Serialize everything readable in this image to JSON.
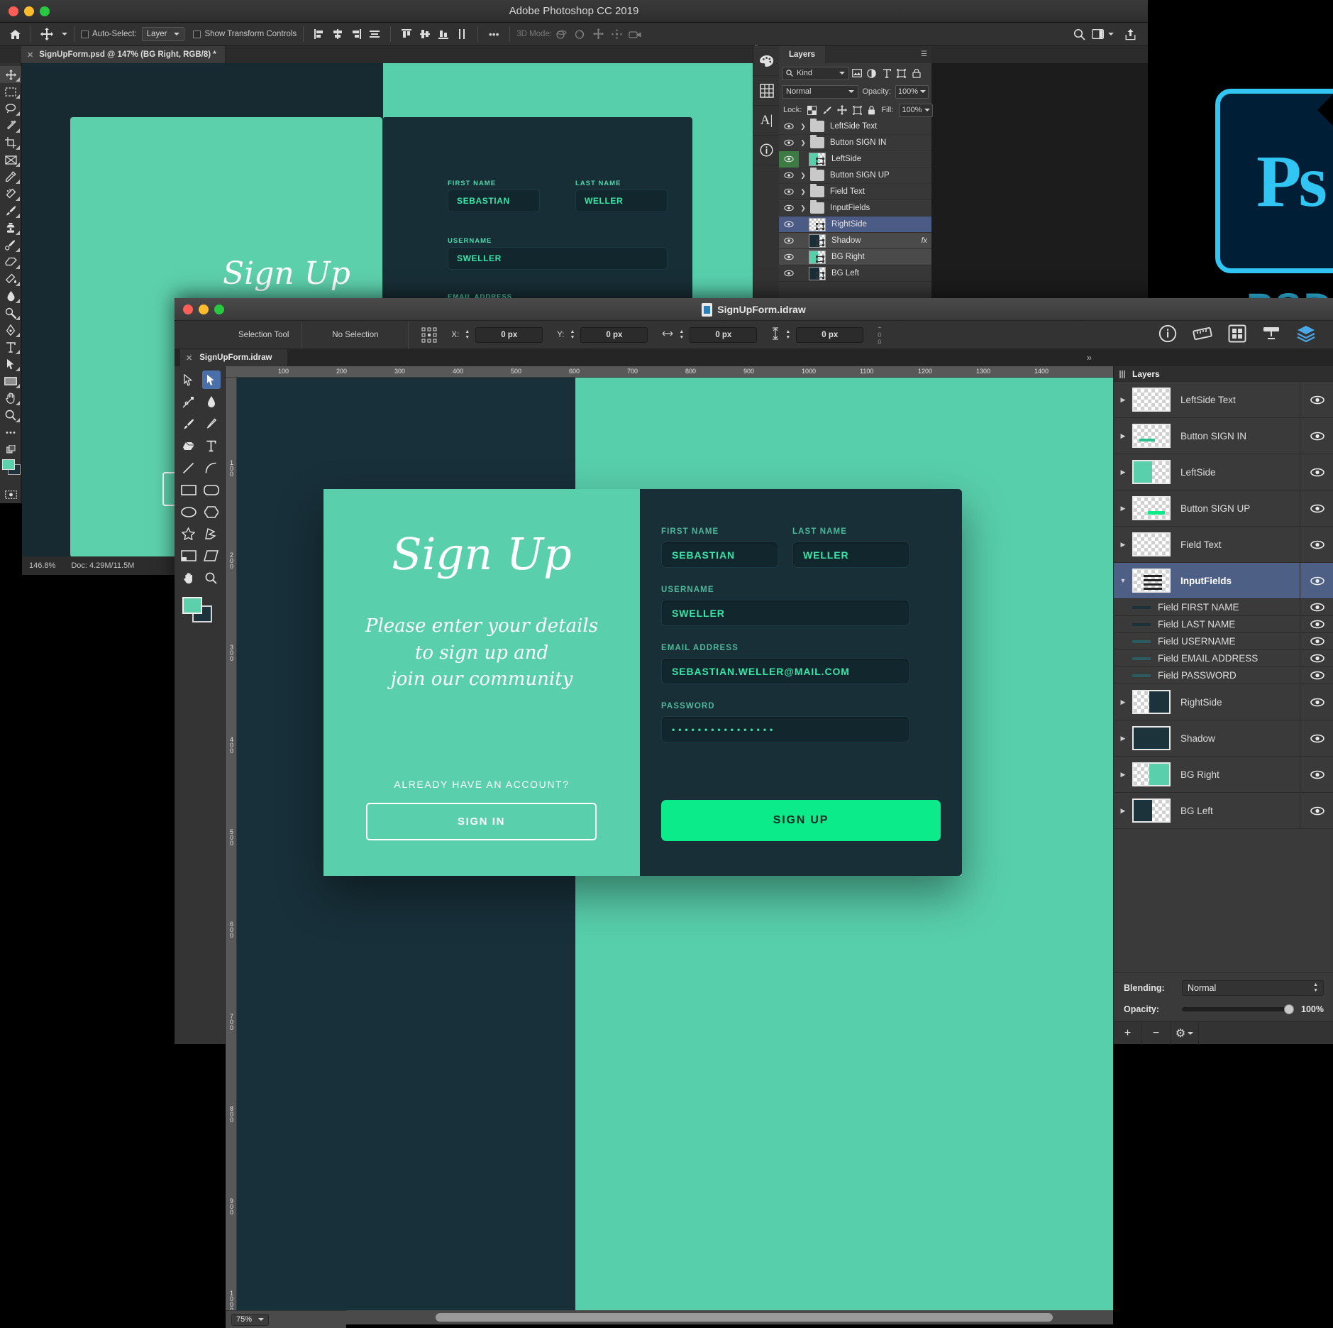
{
  "photoshop": {
    "window_title": "Adobe Photoshop CC 2019",
    "options_bar": {
      "auto_select_label": "Auto-Select:",
      "auto_select_value": "Layer",
      "show_transform_label": "Show Transform Controls",
      "more_label": "•••",
      "mode_3d_label": "3D Mode:"
    },
    "document_tab": "SignUpForm.psd @ 147% (BG Right, RGB/8) *",
    "status": {
      "zoom": "146.8%",
      "doc": "Doc: 4.29M/11.5M"
    },
    "layers_panel": {
      "title": "Layers",
      "filter_kind": "Kind",
      "blend_mode": "Normal",
      "opacity_label": "Opacity:",
      "opacity_value": "100%",
      "lock_label": "Lock:",
      "fill_label": "Fill:",
      "fill_value": "100%",
      "layers": [
        {
          "name": "LeftSide Text",
          "type": "group",
          "selected": "none",
          "fx": ""
        },
        {
          "name": "Button SIGN IN",
          "type": "group",
          "selected": "none",
          "fx": ""
        },
        {
          "name": "LeftSide",
          "type": "image-green",
          "selected": "green-eye",
          "fx": ""
        },
        {
          "name": "Button SIGN UP",
          "type": "group",
          "selected": "none",
          "fx": ""
        },
        {
          "name": "Field Text",
          "type": "group",
          "selected": "none",
          "fx": ""
        },
        {
          "name": "InputFields",
          "type": "group",
          "selected": "none",
          "fx": ""
        },
        {
          "name": "RightSide",
          "type": "image-empty",
          "selected": "blue",
          "fx": ""
        },
        {
          "name": "Shadow",
          "type": "image-dark",
          "selected": "gray",
          "fx": "fx"
        },
        {
          "name": "BG Right",
          "type": "image-green",
          "selected": "gray",
          "fx": ""
        },
        {
          "name": "BG Left",
          "type": "image-dark",
          "selected": "none",
          "fx": ""
        }
      ]
    }
  },
  "psd_badge": {
    "letters": "Ps",
    "label": "PSD",
    "accent": "#31c5f3",
    "bg": "#001e36"
  },
  "idraw": {
    "window_title": "SignUpForm.idraw",
    "toolbar": {
      "tool_name": "Selection Tool",
      "selection_state": "No Selection",
      "x_label": "X:",
      "x_value": "0 px",
      "y_label": "Y:",
      "y_value": "0 px",
      "w_label": "W",
      "w_value": "0 px",
      "h_label": "H",
      "h_value": "0 px"
    },
    "document_tab": "SignUpForm.idraw",
    "status": {
      "zoom": "75%"
    },
    "ruler": {
      "top_ticks": [
        "100",
        "200",
        "300",
        "400",
        "500",
        "600",
        "700",
        "800",
        "900",
        "1000",
        "1100",
        "1200",
        "1300",
        "1400"
      ],
      "left_ticks": [
        "100",
        "200",
        "300",
        "400",
        "500",
        "600",
        "700",
        "800",
        "900",
        "1000"
      ]
    },
    "layers_panel": {
      "title": "Layers",
      "layers": [
        {
          "name": "LeftSide Text",
          "kind": "group",
          "thumb": "empty",
          "selected": false,
          "expanded": false
        },
        {
          "name": "Button SIGN IN",
          "kind": "group",
          "thumb": "bar-teal",
          "selected": false,
          "expanded": false
        },
        {
          "name": "LeftSide",
          "kind": "group",
          "thumb": "green-left",
          "selected": false,
          "expanded": false
        },
        {
          "name": "Button SIGN UP",
          "kind": "group",
          "thumb": "bar-green",
          "selected": false,
          "expanded": false
        },
        {
          "name": "Field Text",
          "kind": "group",
          "thumb": "empty",
          "selected": false,
          "expanded": false
        },
        {
          "name": "InputFields",
          "kind": "group",
          "thumb": "lines",
          "selected": true,
          "expanded": true
        },
        {
          "name": "Field FIRST NAME",
          "kind": "sub",
          "thumb": "dash-dark",
          "selected": false,
          "expanded": false
        },
        {
          "name": "Field LAST NAME",
          "kind": "sub",
          "thumb": "dash-dark",
          "selected": false,
          "expanded": false
        },
        {
          "name": "Field USERNAME",
          "kind": "sub",
          "thumb": "dash-teal",
          "selected": false,
          "expanded": false
        },
        {
          "name": "Field EMAIL ADDRESS",
          "kind": "sub",
          "thumb": "dash-teal",
          "selected": false,
          "expanded": false
        },
        {
          "name": "Field PASSWORD",
          "kind": "sub",
          "thumb": "dash-teal",
          "selected": false,
          "expanded": false
        },
        {
          "name": "RightSide",
          "kind": "group",
          "thumb": "dark-right",
          "selected": false,
          "expanded": false
        },
        {
          "name": "Shadow",
          "kind": "group",
          "thumb": "dark-full",
          "selected": false,
          "expanded": false
        },
        {
          "name": "BG Right",
          "kind": "group",
          "thumb": "green-right",
          "selected": false,
          "expanded": false
        },
        {
          "name": "BG Left",
          "kind": "group",
          "thumb": "dark-left",
          "selected": false,
          "expanded": false
        }
      ],
      "blending_label": "Blending:",
      "blending_value": "Normal",
      "opacity_label": "Opacity:",
      "opacity_value": "100%",
      "add_label": "+",
      "remove_label": "−",
      "settings_label": "⚙"
    }
  },
  "design": {
    "heading": "Sign Up",
    "subheading": "Please enter your details\nto sign up and\njoin our community",
    "already_text": "ALREADY HAVE AN ACCOUNT?",
    "sign_in_button": "SIGN IN",
    "sign_up_button": "SIGN UP",
    "fields": [
      {
        "label": "FIRST NAME",
        "value": "SEBASTIAN"
      },
      {
        "label": "LAST NAME",
        "value": "WELLER"
      },
      {
        "label": "USERNAME",
        "value": "SWELLER"
      },
      {
        "label": "EMAIL ADDRESS",
        "value": "SEBASTIAN.WELLER@MAIL.COM"
      },
      {
        "label": "PASSWORD",
        "value": "••••••••••••••••"
      }
    ],
    "colors": {
      "green": "#59cfab",
      "dark": "#18303a",
      "accent": "#0ceb8a",
      "field_text": "#39e6a8"
    }
  }
}
